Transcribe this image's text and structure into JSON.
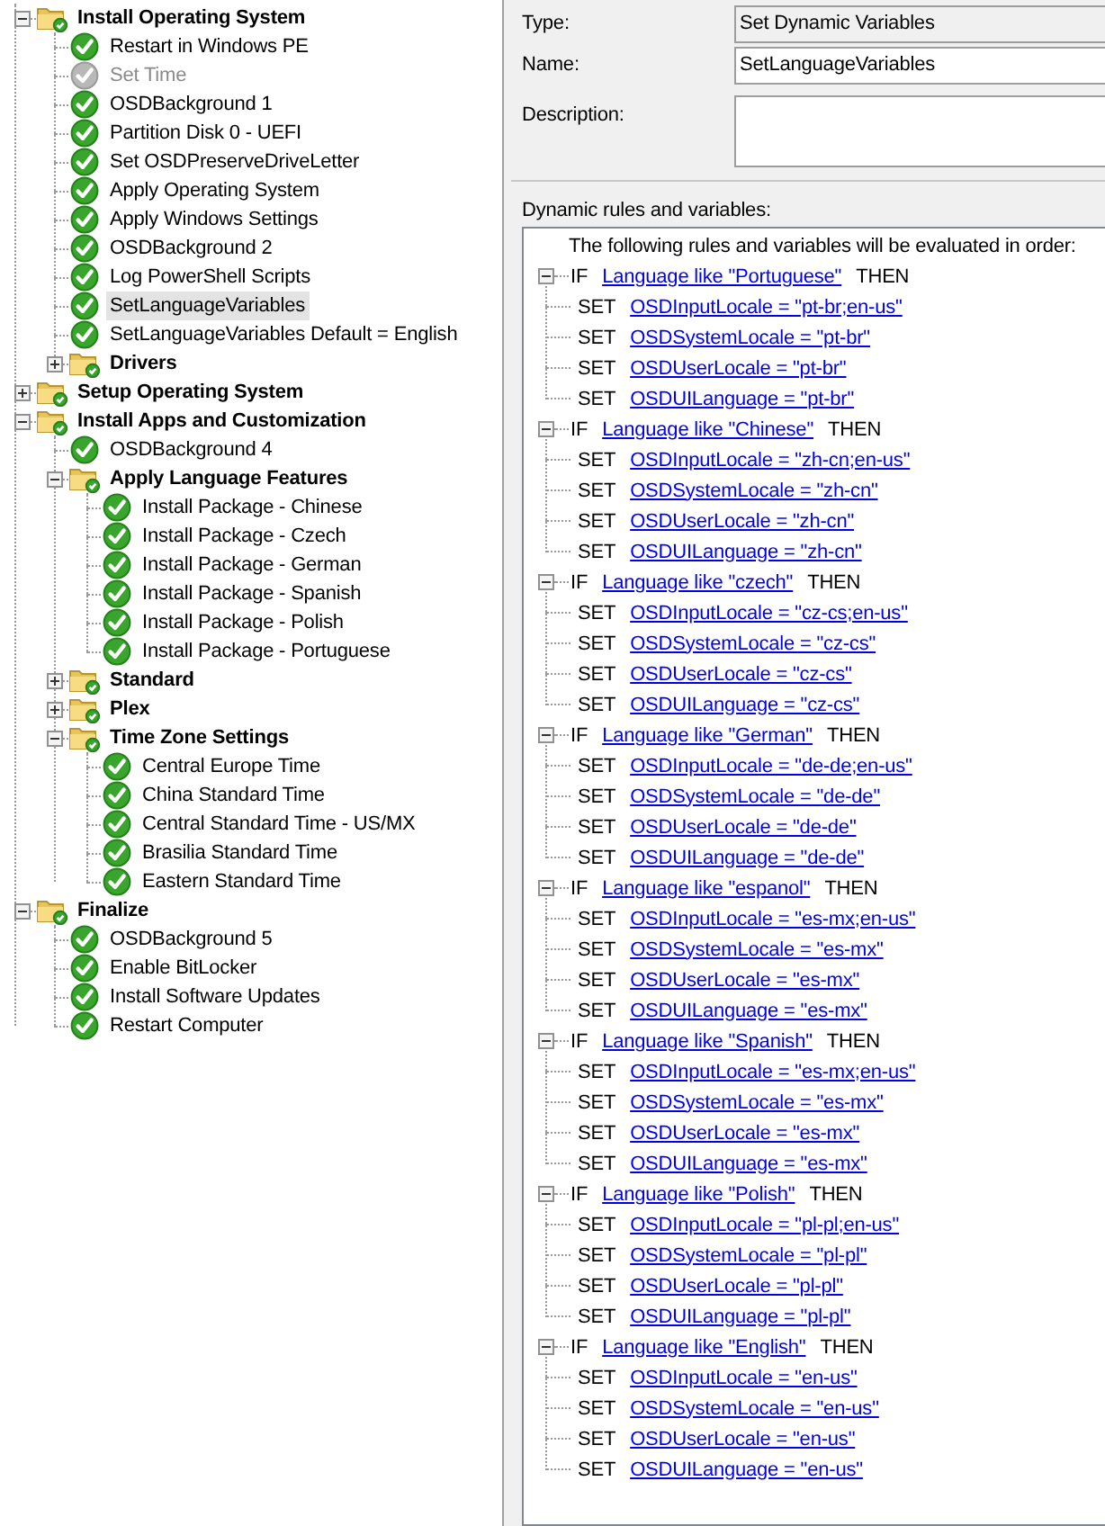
{
  "task_tree": {
    "items": [
      {
        "label": "Install Operating System",
        "kind": "group",
        "expanded": true,
        "disabled": false,
        "selected": false,
        "children": [
          {
            "label": "Restart in Windows PE",
            "kind": "step",
            "disabled": false,
            "selected": false
          },
          {
            "label": "Set Time",
            "kind": "step",
            "disabled": true,
            "selected": false
          },
          {
            "label": "OSDBackground 1",
            "kind": "step",
            "disabled": false,
            "selected": false
          },
          {
            "label": "Partition Disk 0 - UEFI",
            "kind": "step",
            "disabled": false,
            "selected": false
          },
          {
            "label": "Set OSDPreserveDriveLetter",
            "kind": "step",
            "disabled": false,
            "selected": false
          },
          {
            "label": "Apply Operating System",
            "kind": "step",
            "disabled": false,
            "selected": false
          },
          {
            "label": "Apply Windows Settings",
            "kind": "step",
            "disabled": false,
            "selected": false
          },
          {
            "label": "OSDBackground 2",
            "kind": "step",
            "disabled": false,
            "selected": false
          },
          {
            "label": "Log PowerShell Scripts",
            "kind": "step",
            "disabled": false,
            "selected": false
          },
          {
            "label": "SetLanguageVariables",
            "kind": "step",
            "disabled": false,
            "selected": true
          },
          {
            "label": "SetLanguageVariables Default = English",
            "kind": "step",
            "disabled": false,
            "selected": false
          },
          {
            "label": "Drivers",
            "kind": "group",
            "expanded": false,
            "disabled": false,
            "selected": false
          }
        ]
      },
      {
        "label": "Setup Operating System",
        "kind": "group",
        "expanded": false,
        "disabled": false,
        "selected": false
      },
      {
        "label": "Install Apps and Customization",
        "kind": "group",
        "expanded": true,
        "disabled": false,
        "selected": false,
        "children": [
          {
            "label": "OSDBackground 4",
            "kind": "step",
            "disabled": false,
            "selected": false
          },
          {
            "label": "Apply Language Features",
            "kind": "group",
            "expanded": true,
            "disabled": false,
            "selected": false,
            "children": [
              {
                "label": "Install Package - Chinese",
                "kind": "step",
                "disabled": false,
                "selected": false
              },
              {
                "label": "Install Package - Czech",
                "kind": "step",
                "disabled": false,
                "selected": false
              },
              {
                "label": "Install Package - German",
                "kind": "step",
                "disabled": false,
                "selected": false
              },
              {
                "label": "Install Package - Spanish",
                "kind": "step",
                "disabled": false,
                "selected": false
              },
              {
                "label": "Install Package - Polish",
                "kind": "step",
                "disabled": false,
                "selected": false
              },
              {
                "label": "Install Package - Portuguese",
                "kind": "step",
                "disabled": false,
                "selected": false
              }
            ]
          },
          {
            "label": "Standard",
            "kind": "group",
            "expanded": false,
            "disabled": false,
            "selected": false
          },
          {
            "label": "Plex",
            "kind": "group",
            "expanded": false,
            "disabled": false,
            "selected": false
          },
          {
            "label": "Time Zone Settings",
            "kind": "group",
            "expanded": true,
            "disabled": false,
            "selected": false,
            "children": [
              {
                "label": "Central Europe Time",
                "kind": "step",
                "disabled": false,
                "selected": false
              },
              {
                "label": "China Standard Time",
                "kind": "step",
                "disabled": false,
                "selected": false
              },
              {
                "label": "Central Standard Time - US/MX",
                "kind": "step",
                "disabled": false,
                "selected": false
              },
              {
                "label": "Brasilia Standard Time",
                "kind": "step",
                "disabled": false,
                "selected": false
              },
              {
                "label": "Eastern Standard Time",
                "kind": "step",
                "disabled": false,
                "selected": false
              }
            ]
          }
        ]
      },
      {
        "label": "Finalize",
        "kind": "group",
        "expanded": true,
        "disabled": false,
        "selected": false,
        "children": [
          {
            "label": "OSDBackground 5",
            "kind": "step",
            "disabled": false,
            "selected": false
          },
          {
            "label": "Enable BitLocker",
            "kind": "step",
            "disabled": false,
            "selected": false
          },
          {
            "label": "Install Software Updates",
            "kind": "step",
            "disabled": false,
            "selected": false
          },
          {
            "label": "Restart Computer",
            "kind": "step",
            "disabled": false,
            "selected": false
          }
        ]
      }
    ]
  },
  "properties": {
    "type_label": "Type:",
    "type_value": "Set Dynamic Variables",
    "name_label": "Name:",
    "name_value": "SetLanguageVariables",
    "description_label": "Description:"
  },
  "rules": {
    "label": "Dynamic rules and variables:",
    "intro": "The following rules and variables will be evaluated in order:",
    "items": [
      {
        "keyword": "IF",
        "condition": "Language like \"Portuguese\"",
        "then": "THEN",
        "expanded": true,
        "actions": [
          {
            "keyword": "SET",
            "text": "OSDInputLocale = \"pt-br;en-us\""
          },
          {
            "keyword": "SET",
            "text": "OSDSystemLocale = \"pt-br\""
          },
          {
            "keyword": "SET",
            "text": "OSDUserLocale = \"pt-br\""
          },
          {
            "keyword": "SET",
            "text": "OSDUILanguage = \"pt-br\""
          }
        ]
      },
      {
        "keyword": "IF",
        "condition": "Language like \"Chinese\"",
        "then": "THEN",
        "expanded": true,
        "actions": [
          {
            "keyword": "SET",
            "text": "OSDInputLocale = \"zh-cn;en-us\""
          },
          {
            "keyword": "SET",
            "text": "OSDSystemLocale = \"zh-cn\""
          },
          {
            "keyword": "SET",
            "text": "OSDUserLocale = \"zh-cn\""
          },
          {
            "keyword": "SET",
            "text": "OSDUILanguage = \"zh-cn\""
          }
        ]
      },
      {
        "keyword": "IF",
        "condition": "Language like \"czech\"",
        "then": "THEN",
        "expanded": true,
        "actions": [
          {
            "keyword": "SET",
            "text": "OSDInputLocale = \"cz-cs;en-us\""
          },
          {
            "keyword": "SET",
            "text": "OSDSystemLocale = \"cz-cs\""
          },
          {
            "keyword": "SET",
            "text": "OSDUserLocale = \"cz-cs\""
          },
          {
            "keyword": "SET",
            "text": "OSDUILanguage = \"cz-cs\""
          }
        ]
      },
      {
        "keyword": "IF",
        "condition": "Language like \"German\"",
        "then": "THEN",
        "expanded": true,
        "actions": [
          {
            "keyword": "SET",
            "text": "OSDInputLocale = \"de-de;en-us\""
          },
          {
            "keyword": "SET",
            "text": "OSDSystemLocale = \"de-de\""
          },
          {
            "keyword": "SET",
            "text": "OSDUserLocale = \"de-de\""
          },
          {
            "keyword": "SET",
            "text": "OSDUILanguage = \"de-de\""
          }
        ]
      },
      {
        "keyword": "IF",
        "condition": "Language like \"espanol\"",
        "then": "THEN",
        "expanded": true,
        "actions": [
          {
            "keyword": "SET",
            "text": "OSDInputLocale = \"es-mx;en-us\""
          },
          {
            "keyword": "SET",
            "text": "OSDSystemLocale = \"es-mx\""
          },
          {
            "keyword": "SET",
            "text": "OSDUserLocale = \"es-mx\""
          },
          {
            "keyword": "SET",
            "text": "OSDUILanguage = \"es-mx\""
          }
        ]
      },
      {
        "keyword": "IF",
        "condition": "Language like \"Spanish\"",
        "then": "THEN",
        "expanded": true,
        "actions": [
          {
            "keyword": "SET",
            "text": "OSDInputLocale = \"es-mx;en-us\""
          },
          {
            "keyword": "SET",
            "text": "OSDSystemLocale = \"es-mx\""
          },
          {
            "keyword": "SET",
            "text": "OSDUserLocale = \"es-mx\""
          },
          {
            "keyword": "SET",
            "text": "OSDUILanguage = \"es-mx\""
          }
        ]
      },
      {
        "keyword": "IF",
        "condition": "Language like \"Polish\"",
        "then": "THEN",
        "expanded": true,
        "actions": [
          {
            "keyword": "SET",
            "text": "OSDInputLocale = \"pl-pl;en-us\""
          },
          {
            "keyword": "SET",
            "text": "OSDSystemLocale = \"pl-pl\""
          },
          {
            "keyword": "SET",
            "text": "OSDUserLocale = \"pl-pl\""
          },
          {
            "keyword": "SET",
            "text": "OSDUILanguage = \"pl-pl\""
          }
        ]
      },
      {
        "keyword": "IF",
        "condition": "Language like \"English\"",
        "then": "THEN",
        "expanded": true,
        "actions": [
          {
            "keyword": "SET",
            "text": "OSDInputLocale = \"en-us\""
          },
          {
            "keyword": "SET",
            "text": "OSDSystemLocale = \"en-us\""
          },
          {
            "keyword": "SET",
            "text": "OSDUserLocale = \"en-us\""
          },
          {
            "keyword": "SET",
            "text": "OSDUILanguage = \"en-us\""
          }
        ]
      }
    ]
  }
}
